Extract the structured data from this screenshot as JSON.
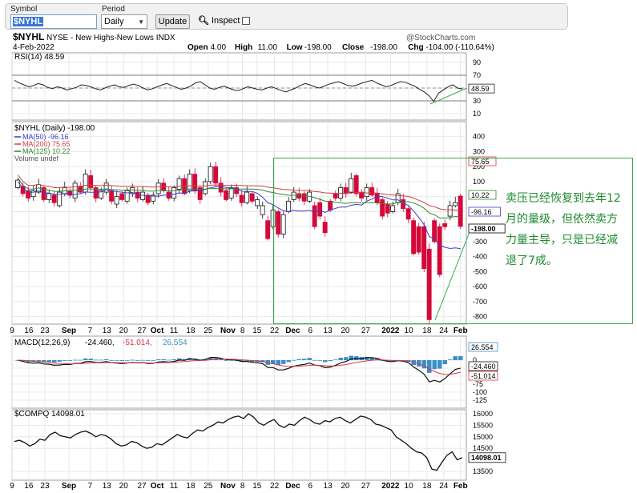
{
  "toolbar": {
    "symbol_label": "Symbol",
    "symbol_value": "$NYHL",
    "period_label": "Period",
    "period_value": "Daily",
    "update_label": "Update",
    "inspect_label": "Inspect"
  },
  "header": {
    "symbol": "$NYHL",
    "name": "NYSE - New Highs-New Lows",
    "exchange": "INDX",
    "watermark": "@StockCharts.com",
    "date": "4-Feb-2022",
    "open_label": "Open",
    "open": "4.00",
    "high_label": "High",
    "high": "11.00",
    "low_label": "Low",
    "low": "-198.00",
    "close_label": "Close",
    "close": "-198.00",
    "chg_label": "Chg",
    "chg": "-104.00 (-110.64%)"
  },
  "colors": {
    "up": "#111111",
    "down": "#d4093a",
    "ma50": "#3b3ccf",
    "ma200": "#d43a47",
    "ma125": "#2f8a2f",
    "macd_hist": "#3a8fc9",
    "annotation": "#1f8a2e"
  },
  "chart_data": [
    {
      "type": "line",
      "panel": "rsi",
      "legend": "RSI(14) 48.59",
      "yticks": [
        90,
        70,
        50,
        30,
        10
      ],
      "ylim": [
        0,
        100
      ],
      "last": "48.59",
      "values": [
        62,
        58,
        55,
        52,
        54,
        57,
        55,
        51,
        49,
        52,
        50,
        47,
        49,
        51,
        55,
        54,
        52,
        49,
        47,
        50,
        53,
        55,
        52,
        51,
        54,
        56,
        54,
        50,
        47,
        49,
        52,
        55,
        57,
        54,
        51,
        48,
        50,
        53,
        58,
        60,
        55,
        50,
        48,
        51,
        53,
        50,
        47,
        46,
        49,
        52,
        50,
        48,
        47,
        50,
        52,
        49,
        46,
        44,
        47,
        50,
        54,
        57,
        55,
        52,
        50,
        53,
        56,
        58,
        60,
        57,
        54,
        53,
        55,
        58,
        60,
        62,
        58,
        55,
        52,
        54,
        57,
        60,
        59,
        56,
        53,
        48,
        44,
        38,
        29,
        42,
        47,
        52,
        55,
        50,
        48.59
      ]
    },
    {
      "type": "bar",
      "panel": "price",
      "legend": {
        "title": "$NYHL (Daily) -198.00",
        "ma50": "MA(50) -96.16",
        "ma200": "MA(200) 75.65",
        "ma125": "MA(125) 10.22",
        "volume": "Volume undef"
      },
      "yticks": [
        400,
        300,
        200,
        100,
        0,
        -100,
        -200,
        -300,
        -400,
        -500,
        -600,
        -700,
        -800
      ],
      "ylim": [
        -850,
        500
      ],
      "badges": {
        "ma200": "75.65",
        "ma125": "10.22",
        "ma50": "-96.16",
        "close": "-198.00"
      },
      "bars": [
        [
          60,
          110
        ],
        [
          70,
          20
        ],
        [
          40,
          -10
        ],
        [
          0,
          40
        ],
        [
          30,
          80
        ],
        [
          60,
          -20
        ],
        [
          -20,
          20
        ],
        [
          10,
          -40
        ],
        [
          -60,
          30
        ],
        [
          20,
          60
        ],
        [
          40,
          10
        ],
        [
          -10,
          90
        ],
        [
          70,
          30
        ],
        [
          30,
          150
        ],
        [
          140,
          60
        ],
        [
          60,
          -10
        ],
        [
          -10,
          40
        ],
        [
          30,
          90
        ],
        [
          40,
          -30
        ],
        [
          -50,
          0
        ],
        [
          20,
          -20
        ],
        [
          -30,
          40
        ],
        [
          20,
          60
        ],
        [
          30,
          -10
        ],
        [
          -20,
          30
        ],
        [
          10,
          -40
        ],
        [
          -30,
          10
        ],
        [
          20,
          90
        ],
        [
          90,
          40
        ],
        [
          30,
          -10
        ],
        [
          -10,
          60
        ],
        [
          50,
          120
        ],
        [
          120,
          20
        ],
        [
          40,
          150
        ],
        [
          150,
          40
        ],
        [
          60,
          -20
        ],
        [
          20,
          100
        ],
        [
          100,
          200
        ],
        [
          200,
          90
        ],
        [
          90,
          30
        ],
        [
          40,
          -20
        ],
        [
          -10,
          60
        ],
        [
          60,
          20
        ],
        [
          10,
          -40
        ],
        [
          -40,
          30
        ],
        [
          20,
          -30
        ],
        [
          -60,
          -20
        ],
        [
          -120,
          -60
        ],
        [
          -160,
          -280
        ],
        [
          -200,
          -90
        ],
        [
          -100,
          -250
        ],
        [
          -250,
          -120
        ],
        [
          -100,
          -30
        ],
        [
          -20,
          30
        ],
        [
          20,
          -10
        ],
        [
          20,
          -30
        ],
        [
          -30,
          30
        ],
        [
          -60,
          -200
        ],
        [
          -40,
          -130
        ],
        [
          -170,
          -240
        ],
        [
          -30,
          -90
        ],
        [
          20,
          -10
        ],
        [
          -10,
          60
        ],
        [
          60,
          20
        ],
        [
          30,
          120
        ],
        [
          140,
          20
        ],
        [
          30,
          -10
        ],
        [
          0,
          60
        ],
        [
          60,
          10
        ],
        [
          20,
          -40
        ],
        [
          -20,
          -130
        ],
        [
          -50,
          -110
        ],
        [
          -100,
          -60
        ],
        [
          -40,
          20
        ],
        [
          -20,
          -80
        ],
        [
          -80,
          -150
        ],
        [
          -160,
          -380
        ],
        [
          -200,
          -370
        ],
        [
          -200,
          -480
        ],
        [
          -350,
          -820
        ],
        [
          -160,
          -300
        ],
        [
          -200,
          -520
        ],
        [
          -180,
          -200
        ],
        [
          -130,
          -60
        ],
        [
          -60,
          -40
        ],
        [
          4,
          -198
        ]
      ]
    },
    {
      "type": "line",
      "panel": "macd",
      "legend": {
        "name": "MACD(12,26,9)",
        "macd": "-24.460",
        "signal": "-51.014",
        "hist": "26.554"
      },
      "yticks": [
        0,
        -25,
        -50,
        -75,
        -100,
        -125
      ],
      "badges": {
        "hist": "26.554",
        "macd": "-24.460",
        "signal": "-51.014"
      }
    },
    {
      "type": "line",
      "panel": "compq",
      "legend": "$COMPQ 14098.01",
      "yticks": [
        16000,
        15500,
        15000,
        14500,
        13500
      ],
      "badge": "14098.01",
      "values": [
        14800,
        14850,
        14750,
        14600,
        14700,
        14900,
        14850,
        15100,
        15200,
        15050,
        15000,
        14950,
        15100,
        15200,
        15250,
        15150,
        15000,
        15100,
        15050,
        14900,
        14700,
        14600,
        14650,
        14800,
        14750,
        14600,
        14500,
        14550,
        14700,
        14650,
        14800,
        14950,
        15100,
        15000,
        14950,
        15150,
        15300,
        15250,
        15400,
        15500,
        15650,
        15600,
        15750,
        15850,
        15900,
        15800,
        16000,
        15850,
        15600,
        15500,
        15650,
        15750,
        15500,
        15400,
        15550,
        15500,
        15700,
        15850,
        15750,
        15600,
        15550,
        15700,
        15650,
        15800,
        15850,
        15700,
        15600,
        15750,
        15900,
        15850,
        15750,
        15550,
        15500,
        15400,
        15300,
        15000,
        14850,
        14700,
        14500,
        14350,
        14300,
        14100,
        13600,
        13550,
        13900,
        14200,
        14350,
        14000,
        14098.01
      ]
    }
  ],
  "xaxis": {
    "labels": [
      "9",
      "16",
      "23",
      "Sep",
      "7",
      "13",
      "20",
      "27",
      "Oct",
      "11",
      "18",
      "25",
      "Nov",
      "8",
      "15",
      "22",
      "Dec",
      "6",
      "13",
      "20",
      "27",
      "2022",
      "10",
      "18",
      "24",
      "Feb"
    ],
    "bold": [
      "Sep",
      "Oct",
      "Nov",
      "Dec",
      "2022",
      "Feb"
    ]
  },
  "annotation": {
    "text": "卖压已经恢复到去年12月的量级，但依然卖方力量主导，只是已经减退了7成。"
  }
}
